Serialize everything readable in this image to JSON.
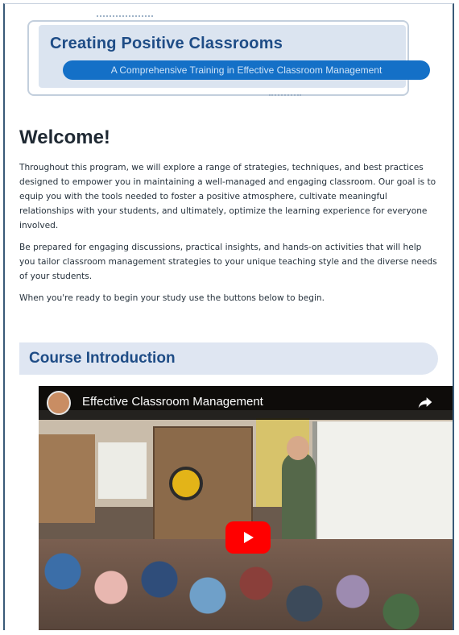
{
  "banner": {
    "title": "Creating Positive Classrooms",
    "subtitle": "A Comprehensive Training in Effective Classroom Management"
  },
  "welcome": {
    "heading": "Welcome!",
    "paragraphs": [
      "Throughout this program, we will explore a range of strategies, techniques, and best practices designed to empower you in maintaining a well-managed and engaging classroom. Our goal is to equip you with the tools needed to foster a positive atmosphere, cultivate meaningful relationships with your students, and ultimately, optimize the learning experience for everyone involved.",
      "Be prepared for engaging discussions, practical insights, and hands-on activities that will help you tailor classroom management strategies to your unique teaching style and the diverse needs of your students.",
      "When you're ready to begin your study use the buttons below to begin."
    ]
  },
  "section": {
    "title": "Course Introduction"
  },
  "video": {
    "title": "Effective Classroom Management",
    "icons": {
      "avatar": "channel-avatar",
      "share": "share-icon",
      "play": "play-icon"
    },
    "play_color": "#ff0000"
  },
  "colors": {
    "brand_blue": "#1e4c86",
    "pill_blue": "#1470c7",
    "panel_bg": "#dbe4f0"
  }
}
